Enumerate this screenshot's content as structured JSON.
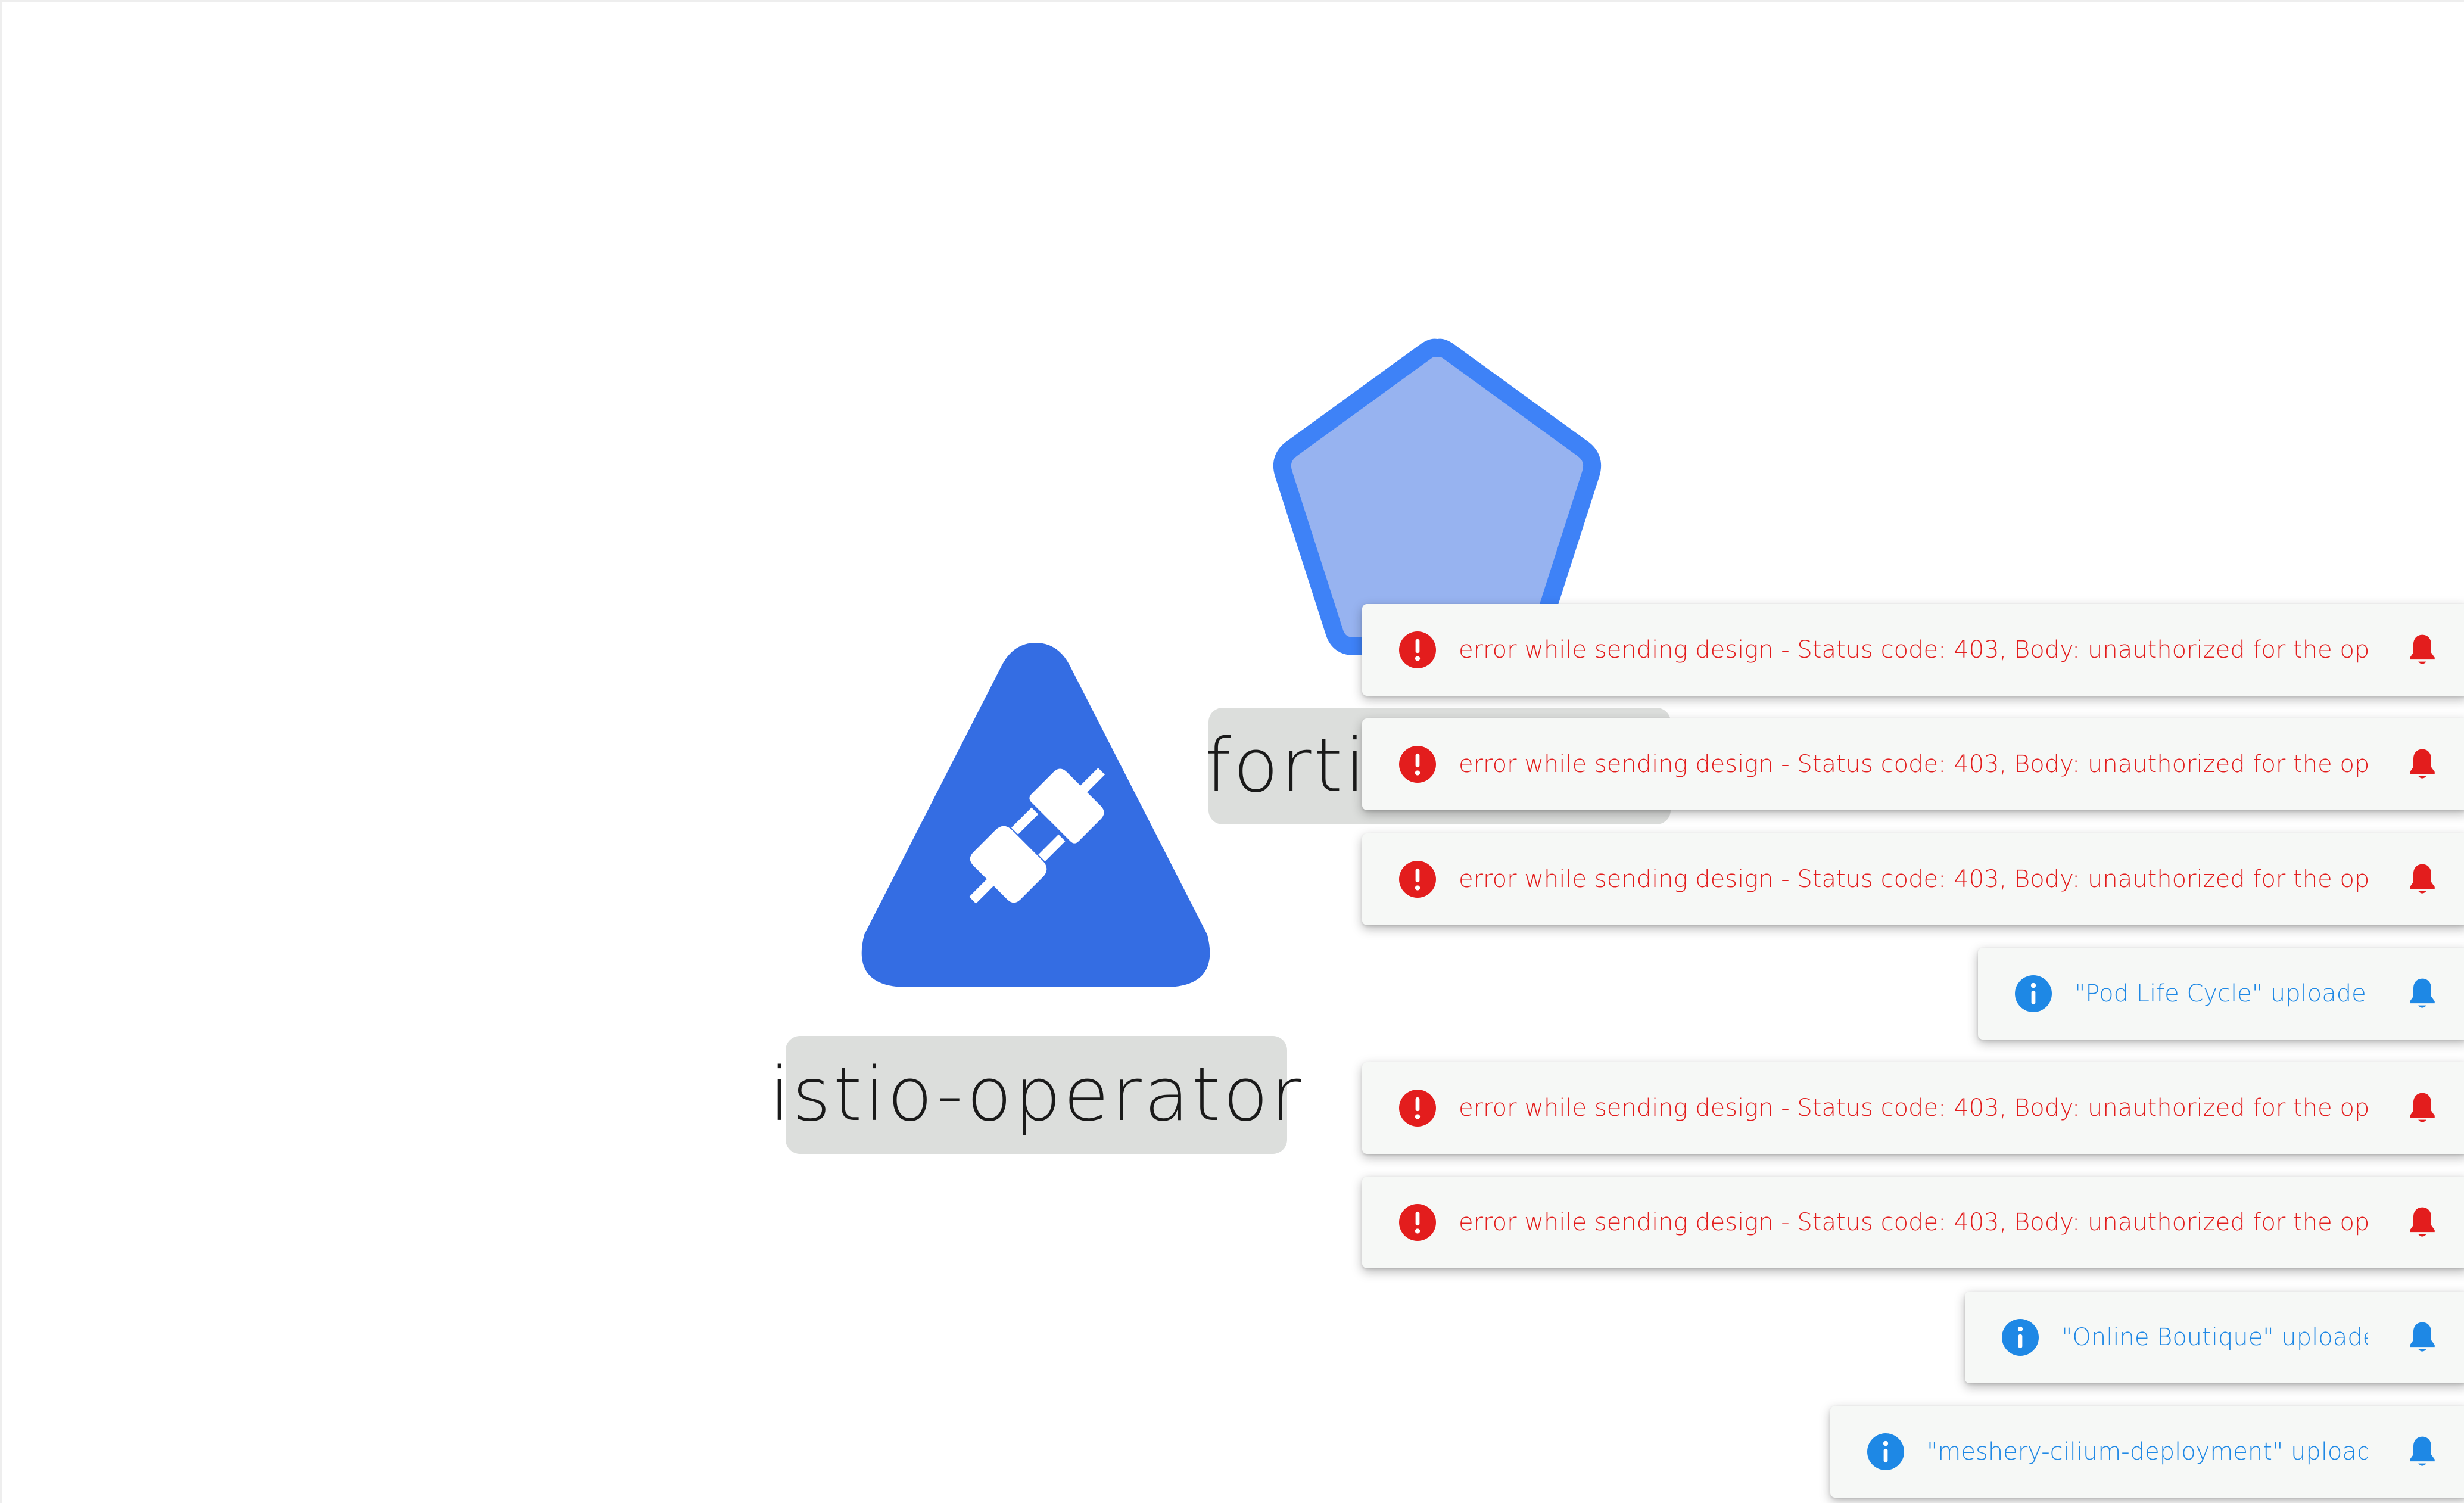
{
  "canvas": {
    "nodes": [
      {
        "id": "istio-operator",
        "label": "istio-operator",
        "shape": "triangle",
        "icon": "plug-connector-icon",
        "fill": "#346de3"
      },
      {
        "id": "fortio",
        "label": "fortio",
        "shape": "pentagon",
        "icon": "",
        "fill": "#97b3f0",
        "stroke": "#3e82f7"
      }
    ]
  },
  "notifications": [
    {
      "type": "error",
      "message": "error while sending design - Status code: 403, Body: unauthorized for the operation",
      "icon": "error-circle-icon",
      "action_icon": "bell-icon"
    },
    {
      "type": "error",
      "message": "error while sending design - Status code: 403, Body: unauthorized for the operation",
      "icon": "error-circle-icon",
      "action_icon": "bell-icon"
    },
    {
      "type": "error",
      "message": "error while sending design - Status code: 403, Body: unauthorized for the operation",
      "icon": "error-circle-icon",
      "action_icon": "bell-icon"
    },
    {
      "type": "info",
      "message": "\"Pod Life Cycle\" uploaded.",
      "icon": "info-circle-icon",
      "action_icon": "bell-icon"
    },
    {
      "type": "error",
      "message": "error while sending design - Status code: 403, Body: unauthorized for the operation",
      "icon": "error-circle-icon",
      "action_icon": "bell-icon"
    },
    {
      "type": "error",
      "message": "error while sending design - Status code: 403, Body: unauthorized for the operation",
      "icon": "error-circle-icon",
      "action_icon": "bell-icon"
    },
    {
      "type": "info",
      "message": "\"Online Boutique\" uploaded.",
      "icon": "info-circle-icon",
      "action_icon": "bell-icon"
    },
    {
      "type": "info",
      "message": "\"meshery-cilium-deployment\" uploaded.",
      "icon": "info-circle-icon",
      "action_icon": "bell-icon"
    }
  ],
  "colors": {
    "error": "#e31d1d",
    "info": "#1e88e5",
    "toast_bg": "#f6f8f6",
    "label_bg": "#dcdedc"
  }
}
